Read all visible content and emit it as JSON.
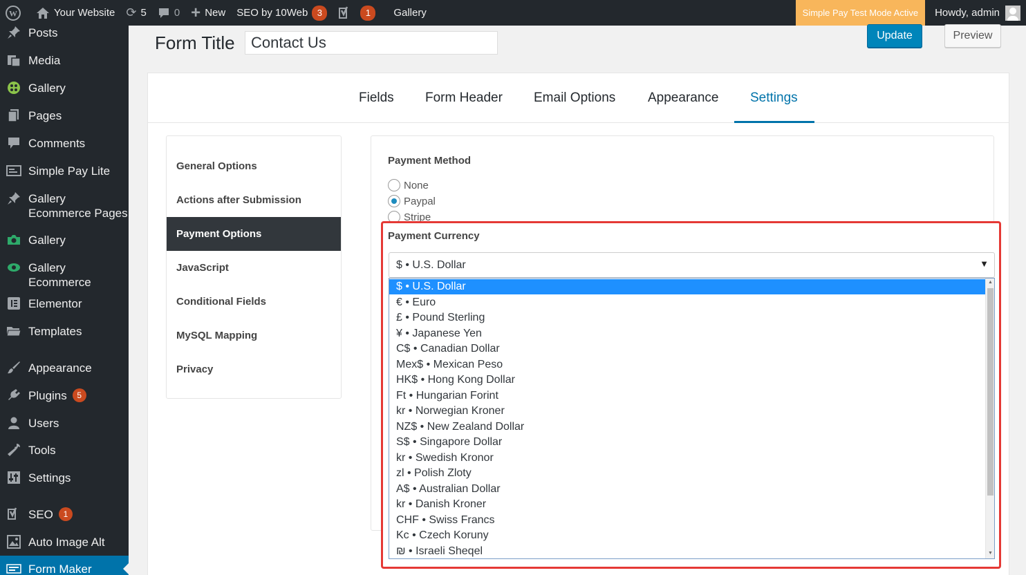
{
  "adminbar": {
    "site_name": "Your Website",
    "updates_count": "5",
    "comments_count": "0",
    "new_label": "New",
    "seo_label": "SEO by 10Web",
    "seo_badge": "3",
    "yoast_badge": "1",
    "gallery_label": "Gallery",
    "test_mode": "Simple Pay Test Mode Active",
    "howdy": "Howdy, admin"
  },
  "sidebar": {
    "items": [
      {
        "label": "Posts",
        "icon": "pin-icon"
      },
      {
        "label": "Media",
        "icon": "media-icon"
      },
      {
        "label": "Gallery",
        "icon": "gallery-icon"
      },
      {
        "label": "Pages",
        "icon": "pages-icon"
      },
      {
        "label": "Comments",
        "icon": "comments-icon"
      },
      {
        "label": "Simple Pay Lite",
        "icon": "simple-pay-icon"
      },
      {
        "label": "Gallery Ecommerce Pages",
        "icon": "pin-icon"
      },
      {
        "label": "Gallery",
        "icon": "camera-icon"
      },
      {
        "label": "Gallery Ecommerce",
        "icon": "eye-icon"
      },
      {
        "label": "Elementor",
        "icon": "elementor-icon"
      },
      {
        "label": "Templates",
        "icon": "folder-icon"
      },
      {
        "label": "Appearance",
        "icon": "brush-icon"
      },
      {
        "label": "Plugins",
        "icon": "plugin-icon",
        "badge": "5"
      },
      {
        "label": "Users",
        "icon": "user-icon"
      },
      {
        "label": "Tools",
        "icon": "wrench-icon"
      },
      {
        "label": "Settings",
        "icon": "settings-icon"
      },
      {
        "label": "SEO",
        "icon": "yoast-icon",
        "badge": "1"
      },
      {
        "label": "Auto Image Alt",
        "icon": "image-alt-icon"
      },
      {
        "label": "Form Maker",
        "icon": "form-maker-icon"
      }
    ]
  },
  "header": {
    "form_title_label": "Form Title",
    "form_title_value": "Contact Us",
    "update_label": "Update",
    "preview_label": "Preview"
  },
  "tabs": [
    "Fields",
    "Form Header",
    "Email Options",
    "Appearance",
    "Settings"
  ],
  "active_tab": "Settings",
  "settings_nav": [
    "General Options",
    "Actions after Submission",
    "Payment Options",
    "JavaScript",
    "Conditional Fields",
    "MySQL Mapping",
    "Privacy"
  ],
  "active_settings_nav": "Payment Options",
  "payment": {
    "method_label": "Payment Method",
    "methods": [
      "None",
      "Paypal",
      "Stripe"
    ],
    "selected_method": "Paypal",
    "currency_label": "Payment Currency",
    "currency_selected": "$ • U.S. Dollar",
    "currency_options": [
      "$ • U.S. Dollar",
      "€ • Euro",
      "£ • Pound Sterling",
      "¥ • Japanese Yen",
      "C$ • Canadian Dollar",
      "Mex$ • Mexican Peso",
      "HK$ • Hong Kong Dollar",
      "Ft • Hungarian Forint",
      "kr • Norwegian Kroner",
      "NZ$ • New Zealand Dollar",
      "S$ • Singapore Dollar",
      "kr • Swedish Kronor",
      "zl • Polish Zloty",
      "A$ • Australian Dollar",
      "kr • Danish Kroner",
      "CHF • Swiss Francs",
      "Kc • Czech Koruny",
      "₪ • Israeli Sheqel"
    ]
  },
  "colors": {
    "admin_dark": "#23282d",
    "wp_blue": "#0073aa",
    "highlight_red": "#e53935",
    "selected_option": "#1e90ff"
  }
}
